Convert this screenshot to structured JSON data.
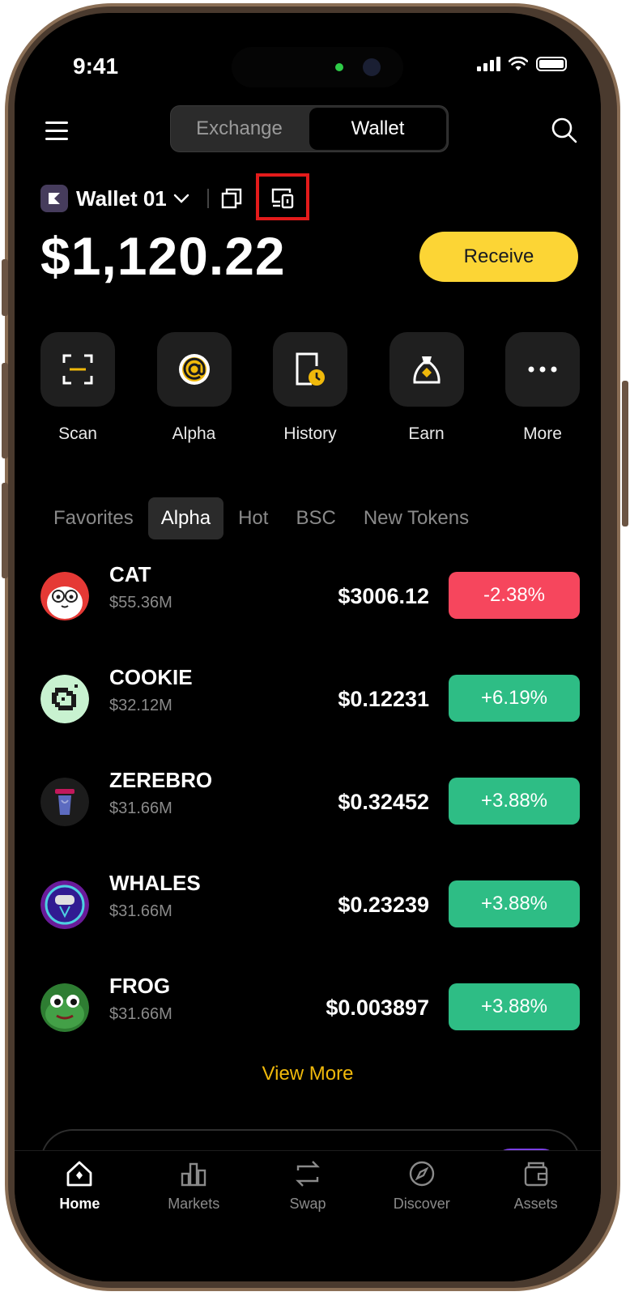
{
  "status": {
    "time": "9:41"
  },
  "header": {
    "tabs": [
      "Exchange",
      "Wallet"
    ],
    "active_tab": "Wallet"
  },
  "wallet": {
    "name": "Wallet 01",
    "balance": "$1,120.22",
    "receive_label": "Receive"
  },
  "actions": [
    {
      "label": "Scan",
      "icon": "scan-icon"
    },
    {
      "label": "Alpha",
      "icon": "alpha-icon"
    },
    {
      "label": "History",
      "icon": "history-icon"
    },
    {
      "label": "Earn",
      "icon": "earn-icon"
    },
    {
      "label": "More",
      "icon": "more-icon"
    }
  ],
  "token_tabs": [
    "Favorites",
    "Alpha",
    "Hot",
    "BSC",
    "New Tokens"
  ],
  "active_token_tab": "Alpha",
  "tokens": [
    {
      "name": "CAT",
      "cap": "$55.36M",
      "price": "$3006.12",
      "change": "-2.38%",
      "direction": "down"
    },
    {
      "name": "COOKIE",
      "cap": "$32.12M",
      "price": "$0.12231",
      "change": "+6.19%",
      "direction": "up"
    },
    {
      "name": "ZEREBRO",
      "cap": "$31.66M",
      "price": "$0.32452",
      "change": "+3.88%",
      "direction": "up"
    },
    {
      "name": "WHALES",
      "cap": "$31.66M",
      "price": "$0.23239",
      "change": "+3.88%",
      "direction": "up"
    },
    {
      "name": "FROG",
      "cap": "$31.66M",
      "price": "$0.003897",
      "change": "+3.88%",
      "direction": "up"
    }
  ],
  "view_more": "View More",
  "nav": [
    {
      "label": "Home",
      "icon": "home-icon"
    },
    {
      "label": "Markets",
      "icon": "markets-icon"
    },
    {
      "label": "Swap",
      "icon": "swap-icon"
    },
    {
      "label": "Discover",
      "icon": "discover-icon"
    },
    {
      "label": "Assets",
      "icon": "assets-icon"
    }
  ],
  "active_nav": "Home",
  "colors": {
    "accent": "#fcd535",
    "up": "#2ebd85",
    "down": "#f6465d",
    "link": "#f0b90b",
    "highlight": "#e31b1b"
  }
}
